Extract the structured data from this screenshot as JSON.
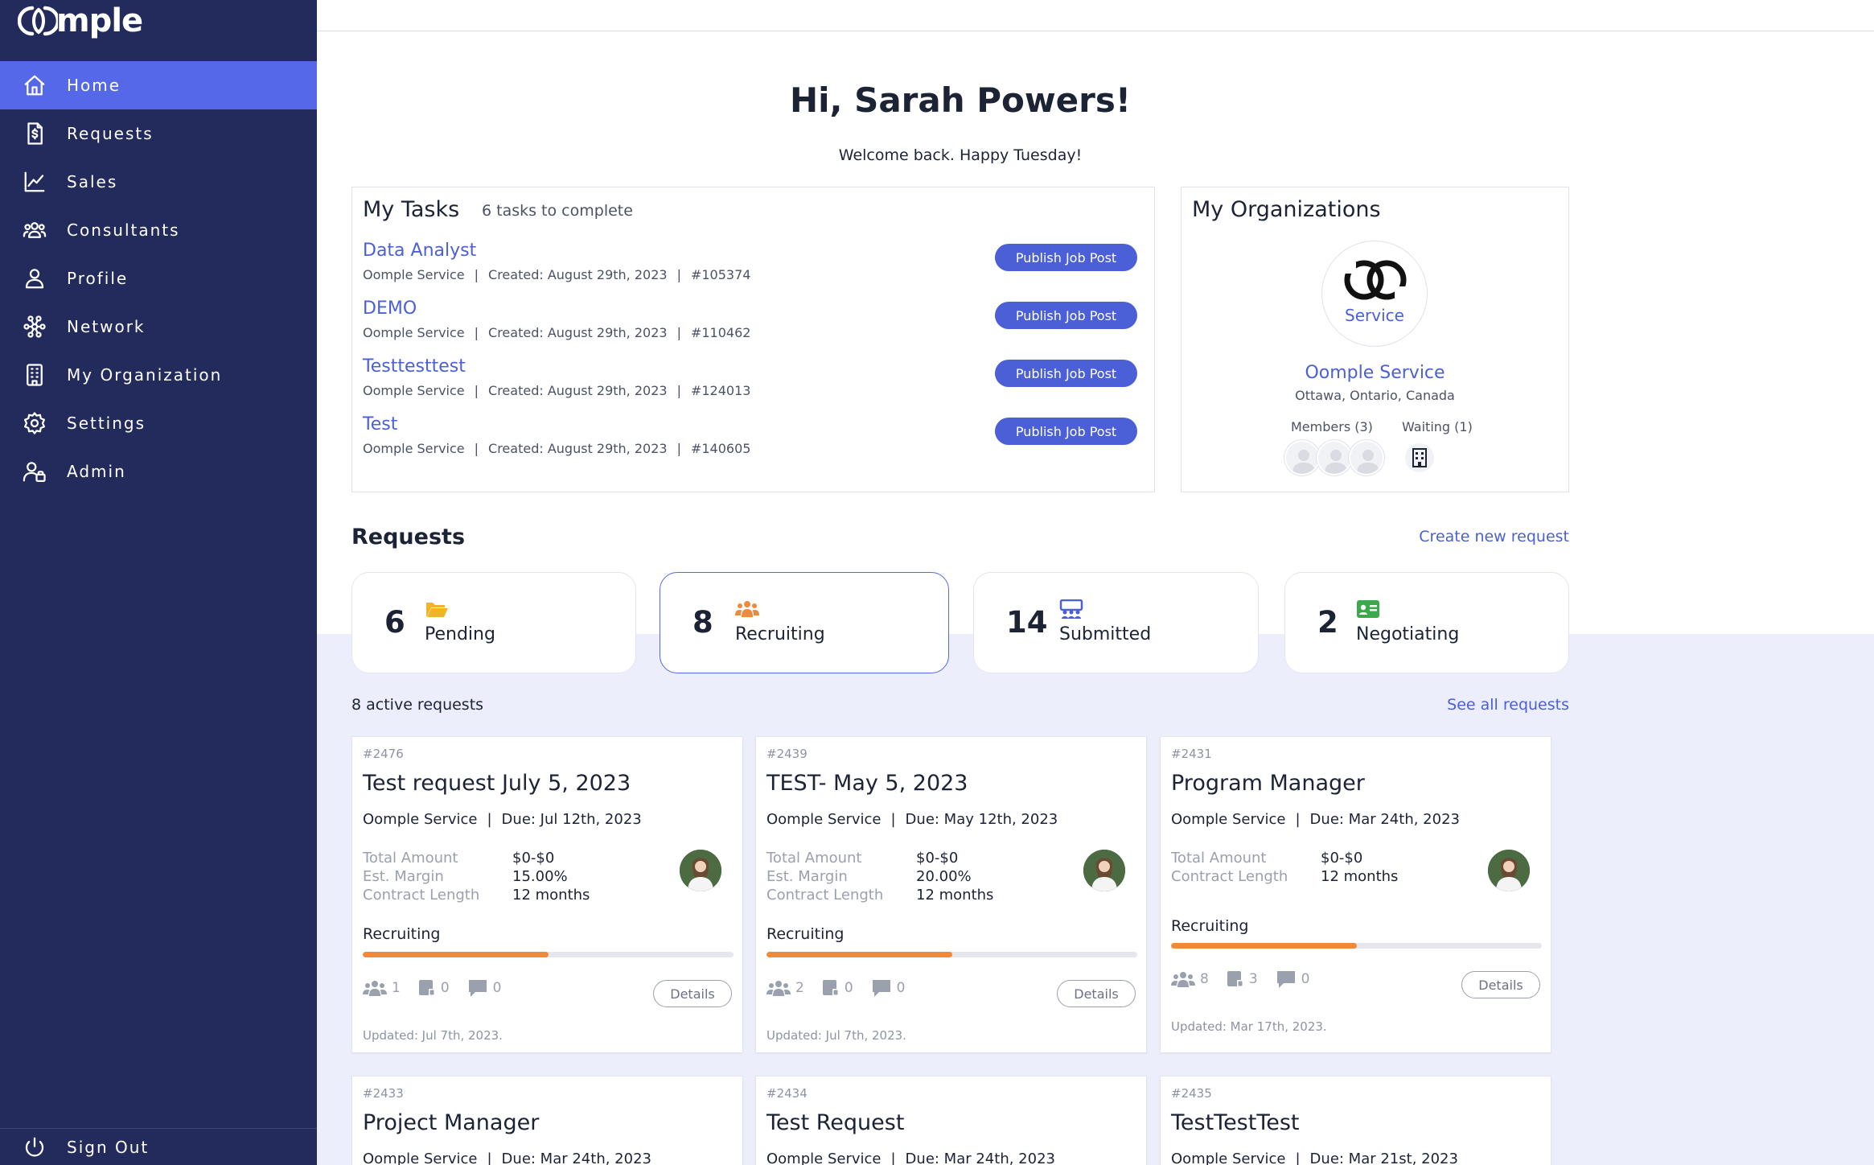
{
  "sidebar": {
    "logo_text": "mple",
    "items": [
      {
        "label": "Home",
        "icon": "home-icon"
      },
      {
        "label": "Requests",
        "icon": "document-dollar-icon"
      },
      {
        "label": "Sales",
        "icon": "chart-line-icon"
      },
      {
        "label": "Consultants",
        "icon": "users-icon"
      },
      {
        "label": "Profile",
        "icon": "user-icon"
      },
      {
        "label": "Network",
        "icon": "network-icon"
      },
      {
        "label": "My Organization",
        "icon": "building-icon"
      },
      {
        "label": "Settings",
        "icon": "gear-icon"
      },
      {
        "label": "Admin",
        "icon": "admin-user-icon"
      }
    ],
    "active": "Home",
    "signout_label": "Sign Out"
  },
  "greeting": "Hi, Sarah Powers!",
  "welcome": "Welcome back. Happy Tuesday!",
  "tasks": {
    "title": "My Tasks",
    "count_text": "6 tasks to complete",
    "items": [
      {
        "title": "Data Analyst",
        "org": "Oomple Service",
        "created": "Created: August 29th, 2023",
        "id": "#105374",
        "button": "Publish Job Post"
      },
      {
        "title": "DEMO",
        "org": "Oomple Service",
        "created": "Created: August 29th, 2023",
        "id": "#110462",
        "button": "Publish Job Post"
      },
      {
        "title": "Testtesttest",
        "org": "Oomple Service",
        "created": "Created: August 29th, 2023",
        "id": "#124013",
        "button": "Publish Job Post"
      },
      {
        "title": "Test",
        "org": "Oomple Service",
        "created": "Created: August 29th, 2023",
        "id": "#140605",
        "button": "Publish Job Post"
      }
    ]
  },
  "organizations": {
    "title": "My Organizations",
    "logo_text": "Service",
    "name": "Oomple Service",
    "location": "Ottawa, Ontario, Canada",
    "members_label": "Members (3)",
    "waiting_label": "Waiting (1)"
  },
  "requests": {
    "title": "Requests",
    "create_link": "Create new request",
    "stats": [
      {
        "count": "6",
        "label": "Pending",
        "icon": "folder-open-icon",
        "color": "#f0b429"
      },
      {
        "count": "8",
        "label": "Recruiting",
        "icon": "users-group-icon",
        "color": "#ef8a3b"
      },
      {
        "count": "14",
        "label": "Submitted",
        "icon": "presentation-users-icon",
        "color": "#4b5fd6"
      },
      {
        "count": "2",
        "label": "Negotiating",
        "icon": "id-card-icon",
        "color": "#3aaa4a"
      }
    ],
    "active_count": "8 active requests",
    "see_all": "See all requests",
    "cards": [
      {
        "id": "#2476",
        "title": "Test request July 5, 2023",
        "org": "Oomple Service",
        "due": "Due: Jul 12th, 2023",
        "rows": [
          [
            "Total Amount",
            "$0-$0"
          ],
          [
            "Est. Margin",
            "15.00%"
          ],
          [
            "Contract Length",
            "12 months"
          ]
        ],
        "status": "Recruiting",
        "progress": 0.5,
        "candidates": "1",
        "submissions": "0",
        "comments": "0",
        "details": "Details",
        "updated": "Updated: Jul 7th, 2023."
      },
      {
        "id": "#2439",
        "title": "TEST- May 5, 2023",
        "org": "Oomple Service",
        "due": "Due: May 12th, 2023",
        "rows": [
          [
            "Total Amount",
            "$0-$0"
          ],
          [
            "Est. Margin",
            "20.00%"
          ],
          [
            "Contract Length",
            "12 months"
          ]
        ],
        "status": "Recruiting",
        "progress": 0.5,
        "candidates": "2",
        "submissions": "0",
        "comments": "0",
        "details": "Details",
        "updated": "Updated: Jul 7th, 2023."
      },
      {
        "id": "#2431",
        "title": "Program Manager",
        "org": "Oomple Service",
        "due": "Due: Mar 24th, 2023",
        "rows": [
          [
            "Total Amount",
            "$0-$0"
          ],
          [
            "Contract Length",
            "12 months"
          ]
        ],
        "status": "Recruiting",
        "progress": 0.5,
        "candidates": "8",
        "submissions": "3",
        "comments": "0",
        "details": "Details",
        "updated": "Updated: Mar 17th, 2023."
      },
      {
        "id": "#2433",
        "title": "Project Manager",
        "org": "Oomple Service",
        "due": "Due: Mar 24th, 2023"
      },
      {
        "id": "#2434",
        "title": "Test Request",
        "org": "Oomple Service",
        "due": "Due: Mar 24th, 2023"
      },
      {
        "id": "#2435",
        "title": "TestTestTest",
        "org": "Oomple Service",
        "due": "Due: Mar 21st, 2023"
      }
    ]
  }
}
